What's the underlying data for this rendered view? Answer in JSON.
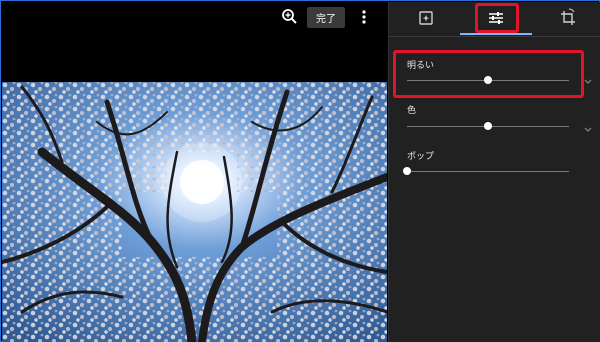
{
  "toolbar": {
    "zoom_icon": "zoom-in-icon",
    "done_label": "完了",
    "more_icon": "more-vert-icon"
  },
  "tabs": [
    {
      "name": "auto-fix",
      "icon": "auto-enhance-icon"
    },
    {
      "name": "adjust",
      "icon": "tune-icon",
      "selected": true
    },
    {
      "name": "crop-rotate",
      "icon": "crop-rotate-icon"
    }
  ],
  "adjustments": [
    {
      "label": "明るい",
      "value": 0.5,
      "expandable": true,
      "highlighted": true
    },
    {
      "label": "色",
      "value": 0.5,
      "expandable": true,
      "highlighted": false
    },
    {
      "label": "ポップ",
      "value": 0.0,
      "expandable": false,
      "highlighted": false
    }
  ],
  "colors": {
    "accent": "#8ab4f8",
    "highlight": "#e3132b",
    "panel_bg": "#212121"
  }
}
